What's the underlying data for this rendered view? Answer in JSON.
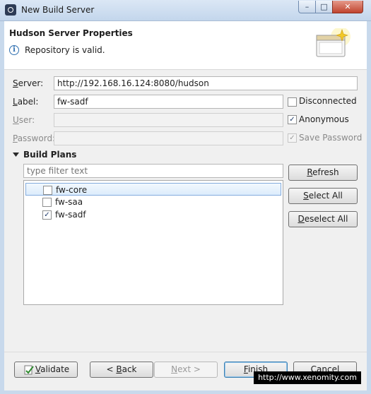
{
  "window": {
    "title": "New Build Server",
    "minimize": "–",
    "maximize": "□",
    "close": "✕"
  },
  "header": {
    "title": "Hudson Server Properties",
    "status_message": "Repository is valid."
  },
  "form": {
    "server": {
      "label_key": "S",
      "label_rest": "erver:",
      "value": "http://192.168.16.124:8080/hudson"
    },
    "label": {
      "label_key": "L",
      "label_rest": "abel:",
      "value": "fw-sadf"
    },
    "user": {
      "label_key": "U",
      "label_rest": "ser:",
      "value": ""
    },
    "password": {
      "label_key": "P",
      "label_rest": "assword:",
      "value": ""
    },
    "disconnected": {
      "label": "Disconnected",
      "checked": false
    },
    "anonymous": {
      "label": "Anonymous",
      "checked": true
    },
    "save_password": {
      "label": "Save Password",
      "checked": true
    }
  },
  "build_plans": {
    "title": "Build Plans",
    "filter_placeholder": "type filter text",
    "items": [
      {
        "label": "fw-core",
        "checked": false,
        "selected": true
      },
      {
        "label": "fw-saa",
        "checked": false,
        "selected": false
      },
      {
        "label": "fw-sadf",
        "checked": true,
        "selected": false
      }
    ],
    "refresh_key": "R",
    "refresh_rest": "efresh",
    "select_all_pre": "",
    "select_all_key": "S",
    "select_all_rest": "elect All",
    "deselect_all_pre": "",
    "deselect_all_key": "D",
    "deselect_all_rest": "eselect All"
  },
  "footer": {
    "validate_key": "V",
    "validate_rest": "alidate",
    "back_pre": "< ",
    "back_key": "B",
    "back_rest": "ack",
    "next_pre": "",
    "next_key": "N",
    "next_rest": "ext >",
    "finish_key": "F",
    "finish_rest": "inish",
    "cancel": "Cancel"
  },
  "watermark": "http://www.xenomity.com",
  "icons": {
    "info": "info-icon",
    "wizard": "wizard-banner-icon",
    "validate": "validate-icon",
    "expand": "triangle-down-icon"
  },
  "colors": {
    "selection": "#dcecfc",
    "title_bar": "#c3d6ec",
    "close_button": "#c0442f"
  }
}
